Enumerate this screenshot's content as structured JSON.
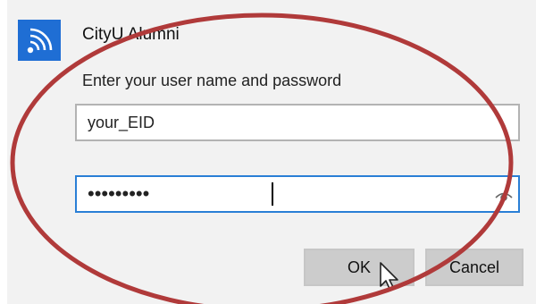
{
  "network": {
    "name": "CityU Alumni",
    "icon": "wifi-icon"
  },
  "prompt": "Enter your user name and password",
  "username": {
    "value": "your_EID"
  },
  "password": {
    "value": "•••••••••",
    "reveal_icon": "eye-icon"
  },
  "buttons": {
    "ok": "OK",
    "cancel": "Cancel"
  },
  "colors": {
    "accent": "#1f6ed4",
    "annotation": "#b03a3a",
    "focus_border": "#2a7fd6"
  }
}
